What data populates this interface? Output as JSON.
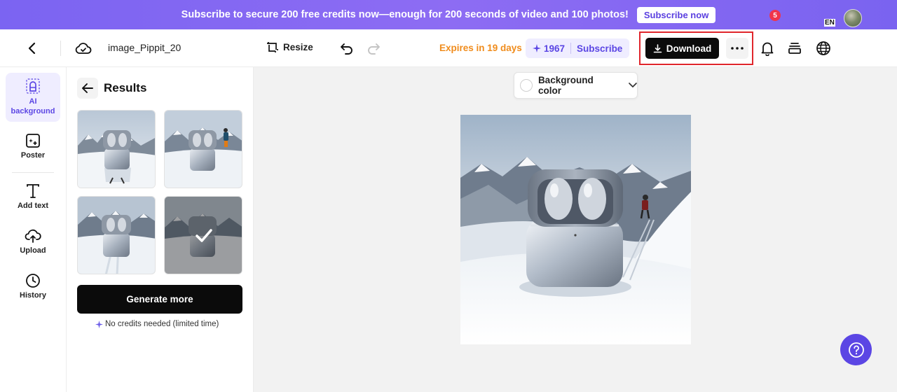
{
  "banner": {
    "text": "Subscribe to secure 200 free credits now—enough for 200 seconds of video and 100 photos!",
    "button": "Subscribe now"
  },
  "toolbar": {
    "doc_title": "image_Pippit_20",
    "resize_label": "Resize",
    "expires_label": "Expires in 19 days",
    "credits": "1967",
    "subscribe_label": "Subscribe",
    "download_label": "Download",
    "notification_count": "5",
    "language_code": "EN"
  },
  "rail": {
    "items": [
      {
        "label": "AI background",
        "icon": "ai-background-icon"
      },
      {
        "label": "Poster",
        "icon": "poster-icon"
      },
      {
        "label": "Add text",
        "icon": "text-icon"
      },
      {
        "label": "Upload",
        "icon": "upload-icon"
      },
      {
        "label": "History",
        "icon": "history-icon"
      }
    ]
  },
  "results": {
    "title": "Results",
    "selected_index": 3,
    "generate_label": "Generate more",
    "credits_note": "No credits needed (limited time)"
  },
  "canvas": {
    "background_color_label": "Background color"
  },
  "colors": {
    "brand": "#5b46e4",
    "banner": "#8068f2",
    "expires": "#f08c1c",
    "highlight_box": "#e0262c"
  }
}
